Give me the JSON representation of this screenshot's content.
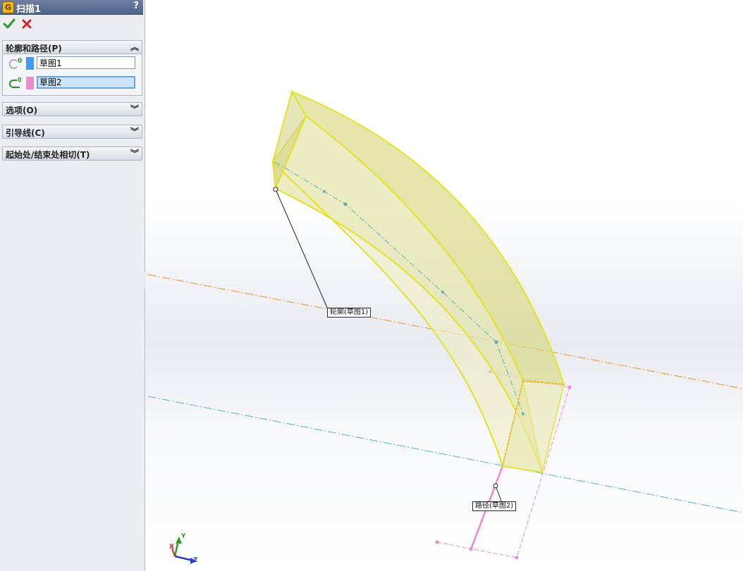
{
  "feature": {
    "title": "扫描1",
    "title_icon": "G",
    "help": "?"
  },
  "groups": {
    "profile_path": {
      "title": "轮廓和路径(P)",
      "expanded": true,
      "profile_value": "草图1",
      "path_value": "草图2",
      "profile_color": "#3d9cf0",
      "path_color": "#f08ac8"
    },
    "options": {
      "title": "选项(O)"
    },
    "guide_curves": {
      "title": "引导线(C)"
    },
    "start_end_tangency": {
      "title": "起始处/结束处相切(T)"
    }
  },
  "callouts": {
    "profile": "轮廓(草图1)",
    "path": "路径(草图2)"
  },
  "triad": {
    "x": "X",
    "y": "Y",
    "z": "Z"
  },
  "colors": {
    "sweep_face": "#e6e69a",
    "sweep_edge": "#e2e22a",
    "axis_orange": "#f0902a",
    "axis_blue": "#5aaed8",
    "path_pink": "#f08ac8"
  }
}
